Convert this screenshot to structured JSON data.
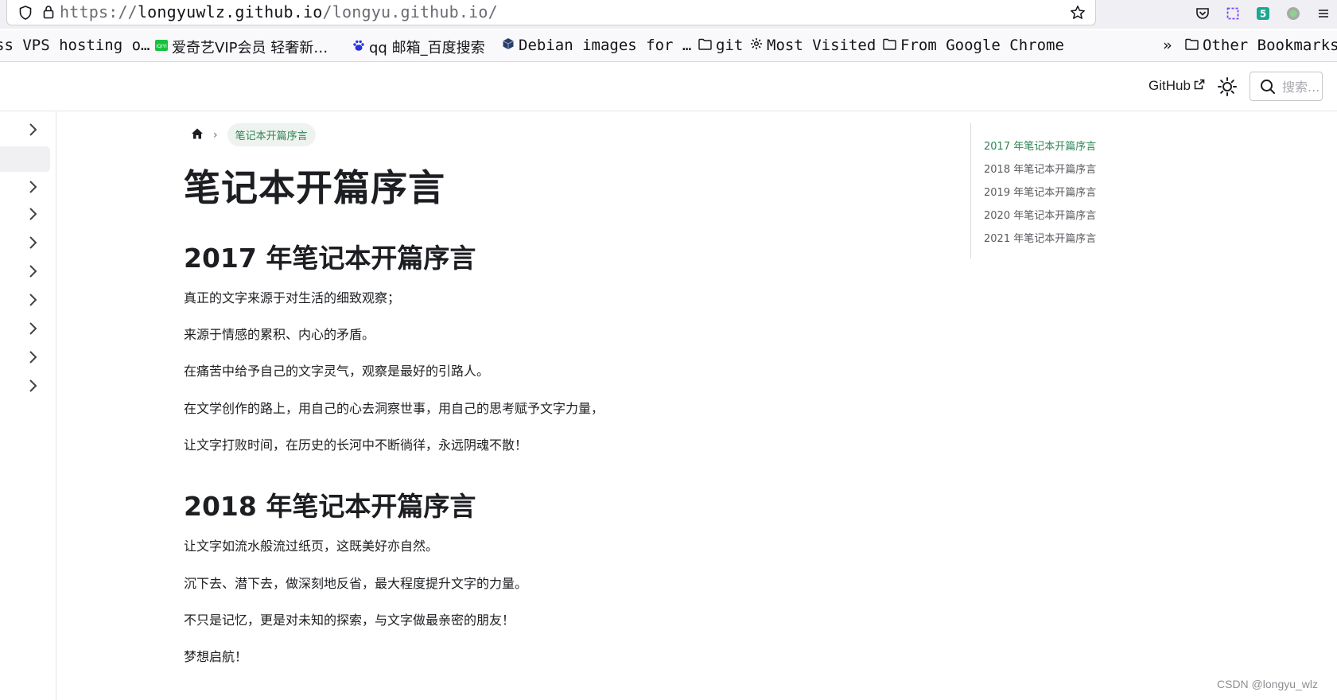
{
  "browser": {
    "url_prefix": "https://",
    "url_host": "longyuwlz.github.io",
    "url_path": "/longyu.github.io/",
    "extension_badge": "5"
  },
  "bookmarks": {
    "items": [
      {
        "label": "ss VPS hosting o…",
        "icon": "none"
      },
      {
        "label": "爱奇艺VIP会员 轻奢新…",
        "icon": "iqiyi-icon"
      },
      {
        "label": "qq 邮箱_百度搜索",
        "icon": "baidu-paw-icon"
      },
      {
        "label": "Debian images for …",
        "icon": "cube-icon"
      },
      {
        "label": "git",
        "icon": "folder-icon"
      },
      {
        "label": "Most Visited",
        "icon": "gear-icon"
      },
      {
        "label": "From Google Chrome",
        "icon": "folder-icon"
      }
    ],
    "overflow_label": "»",
    "other_label": "Other Bookmarks"
  },
  "header": {
    "github_label": "GitHub",
    "search_placeholder": "搜索..."
  },
  "breadcrumb": {
    "current": "笔记本开篇序言"
  },
  "content": {
    "title": "笔记本开篇序言",
    "sections": [
      {
        "heading": "2017 年笔记本开篇序言",
        "paragraphs": [
          "真正的文字来源于对生活的细致观察；",
          "来源于情感的累积、内心的矛盾。",
          "在痛苦中给予自己的文字灵气，观察是最好的引路人。",
          "在文学创作的路上，用自己的心去洞察世事，用自己的思考赋予文字力量，",
          "让文字打败时间，在历史的长河中不断徜徉，永远阴魂不散！"
        ]
      },
      {
        "heading": "2018 年笔记本开篇序言",
        "paragraphs": [
          "让文字如流水般流过纸页，这既美好亦自然。",
          "沉下去、潜下去，做深刻地反省，最大程度提升文字的力量。",
          "不只是记忆，更是对未知的探索，与文字做最亲密的朋友！",
          "梦想启航！"
        ]
      }
    ]
  },
  "toc": {
    "items": [
      "2017 年笔记本开篇序言",
      "2018 年笔记本开篇序言",
      "2019 年笔记本开篇序言",
      "2020 年笔记本开篇序言",
      "2021 年笔记本开篇序言"
    ],
    "active_index": 0
  },
  "watermark": "CSDN @longyu_wlz",
  "colors": {
    "accent": "#2e8555",
    "text": "#1c1e21"
  }
}
